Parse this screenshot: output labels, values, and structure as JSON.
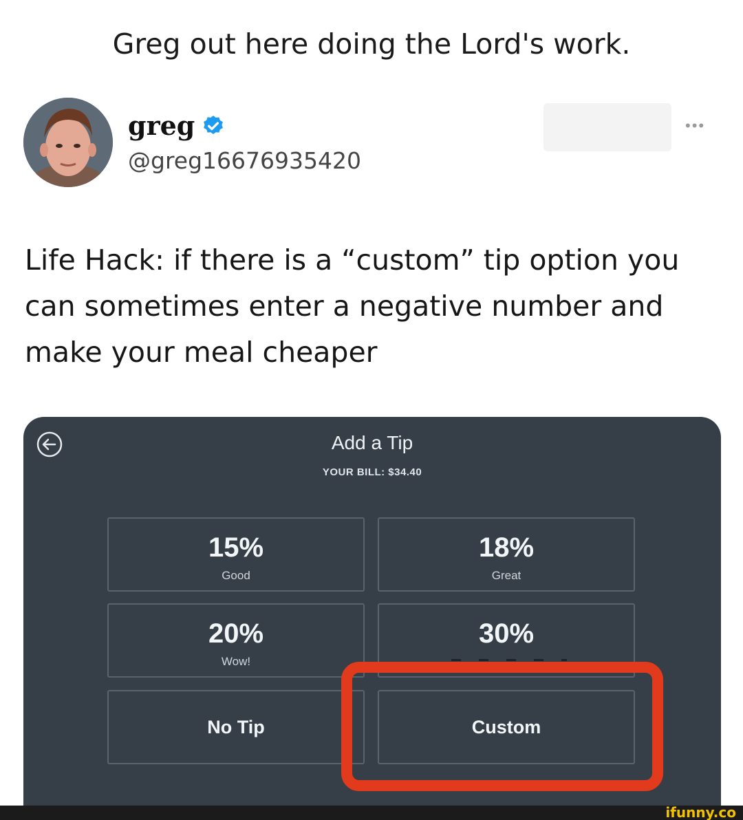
{
  "caption": "Greg out here doing the Lord's work.",
  "tweet": {
    "display_name": "greg",
    "handle": "@greg16676935420",
    "verified_icon": "verified-badge-icon",
    "text": "Life Hack: if there is a “custom” tip option you can sometimes enter a negative number and make your meal cheaper"
  },
  "tip_screen": {
    "title": "Add a Tip",
    "bill": "YOUR BILL: $34.40",
    "options": [
      {
        "pct": "15%",
        "label": "Good"
      },
      {
        "pct": "18%",
        "label": "Great"
      },
      {
        "pct": "20%",
        "label": "Wow!"
      },
      {
        "pct": "30%",
        "label": ""
      },
      {
        "label": "No Tip"
      },
      {
        "label": "Custom"
      }
    ],
    "highlight_color": "#e23a1c",
    "background_color": "#363f47"
  },
  "watermark": "ifunny.co"
}
